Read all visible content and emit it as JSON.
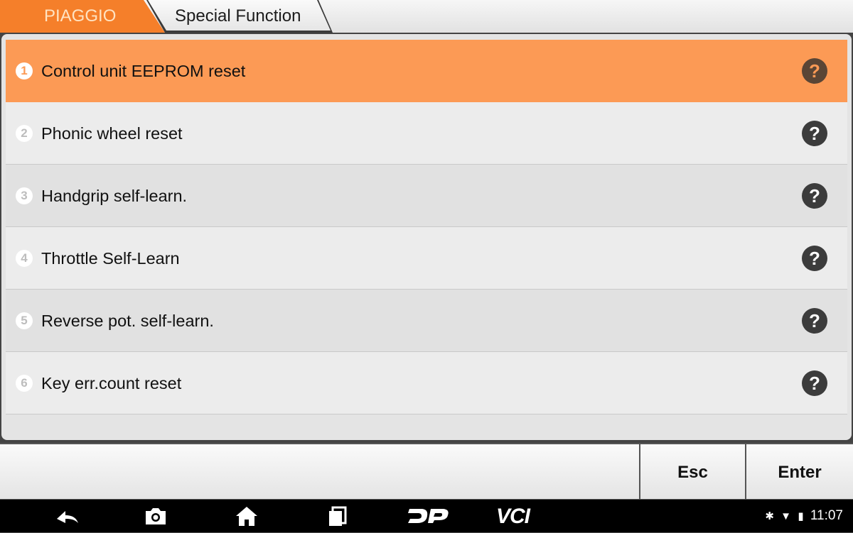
{
  "breadcrumb": {
    "brand": "PIAGGIO",
    "page": "Special Function"
  },
  "functions": [
    {
      "num": "1",
      "label": "Control unit EEPROM reset",
      "selected": true
    },
    {
      "num": "2",
      "label": "Phonic wheel reset",
      "selected": false
    },
    {
      "num": "3",
      "label": "Handgrip self-learn.",
      "selected": false
    },
    {
      "num": "4",
      "label": "Throttle Self-Learn",
      "selected": false
    },
    {
      "num": "5",
      "label": "Reverse pot. self-learn.",
      "selected": false
    },
    {
      "num": "6",
      "label": "Key err.count reset",
      "selected": false
    }
  ],
  "help_glyph": "?",
  "actions": {
    "esc": "Esc",
    "enter": "Enter"
  },
  "navbar": {
    "icons": [
      "back-icon",
      "screenshot-icon",
      "home-icon",
      "recent-apps-icon",
      "dp-logo-icon",
      "vci-icon"
    ],
    "vci_label": "VCI"
  },
  "status": {
    "icons": [
      "bluetooth-icon",
      "wifi-icon",
      "battery-icon"
    ],
    "time": "11:07"
  },
  "colors": {
    "accent": "#f57f2a",
    "selected_row": "#fc9a55"
  }
}
